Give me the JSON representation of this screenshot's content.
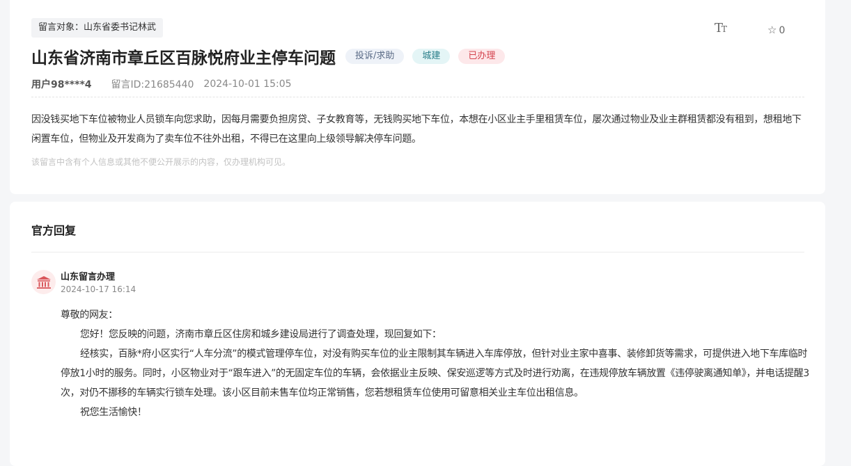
{
  "message": {
    "target": "留言对象：山东省委书记林武",
    "title": "山东省济南市章丘区百脉悦府业主停车问题",
    "badges": {
      "type": "投诉/求助",
      "domain": "城建",
      "status": "已办理"
    },
    "user": "用户98****4",
    "message_id": "留言ID:21685440",
    "time": "2024-10-01 15:05",
    "content": "因没钱买地下车位被物业人员锁车向您求助，因每月需要负担房贷、子女教育等，无钱购买地下车位，本想在小区业主手里租赁车位，屡次通过物业及业主群租赁都没有租到，想租地下闲置车位，但物业及开发商为了卖车位不往外出租，不得已在这里向上级领导解决停车问题。",
    "privacy_note": "该留言中含有个人信息或其他不便公开展示的内容，仅办理机构可见。"
  },
  "toolbar": {
    "font_size_icon": "text-size-icon",
    "font_big": "T",
    "font_small": "T",
    "favorite_icon": "star-icon",
    "favorite_count": "0"
  },
  "reply": {
    "section_title": "官方回复",
    "org_icon": "government-building-icon",
    "org_name": "山东留言办理",
    "time": "2024-10-17 16:14",
    "greeting": "尊敬的网友：",
    "paragraphs": [
      "您好！您反映的问题，济南市章丘区住房和城乡建设局进行了调查处理，现回复如下：",
      "经核实，百脉*府小区实行“人车分流”的模式管理停车位，对没有购买车位的业主限制其车辆进入车库停放，但针对业主家中喜事、装修卸货等需求，可提供进入地下车库临时停放1小时的服务。同时，小区物业对于“跟车进入”的无固定车位的车辆，会依据业主反映、保安巡逻等方式及时进行劝离，在违规停放车辆放置《违停驶离通知单》，并电话提醒3次，对仍不挪移的车辆实行锁车处理。该小区目前未售车位均正常销售，您若想租赁车位使用可留意相关业主车位出租信息。",
      "祝您生活愉快！"
    ]
  },
  "colors": {
    "page_background": "#f5f6f8",
    "card_background": "#ffffff",
    "status_red": "#d4434e",
    "domain_teal": "#2a7f8a",
    "avatar_red": "#d9575c"
  }
}
